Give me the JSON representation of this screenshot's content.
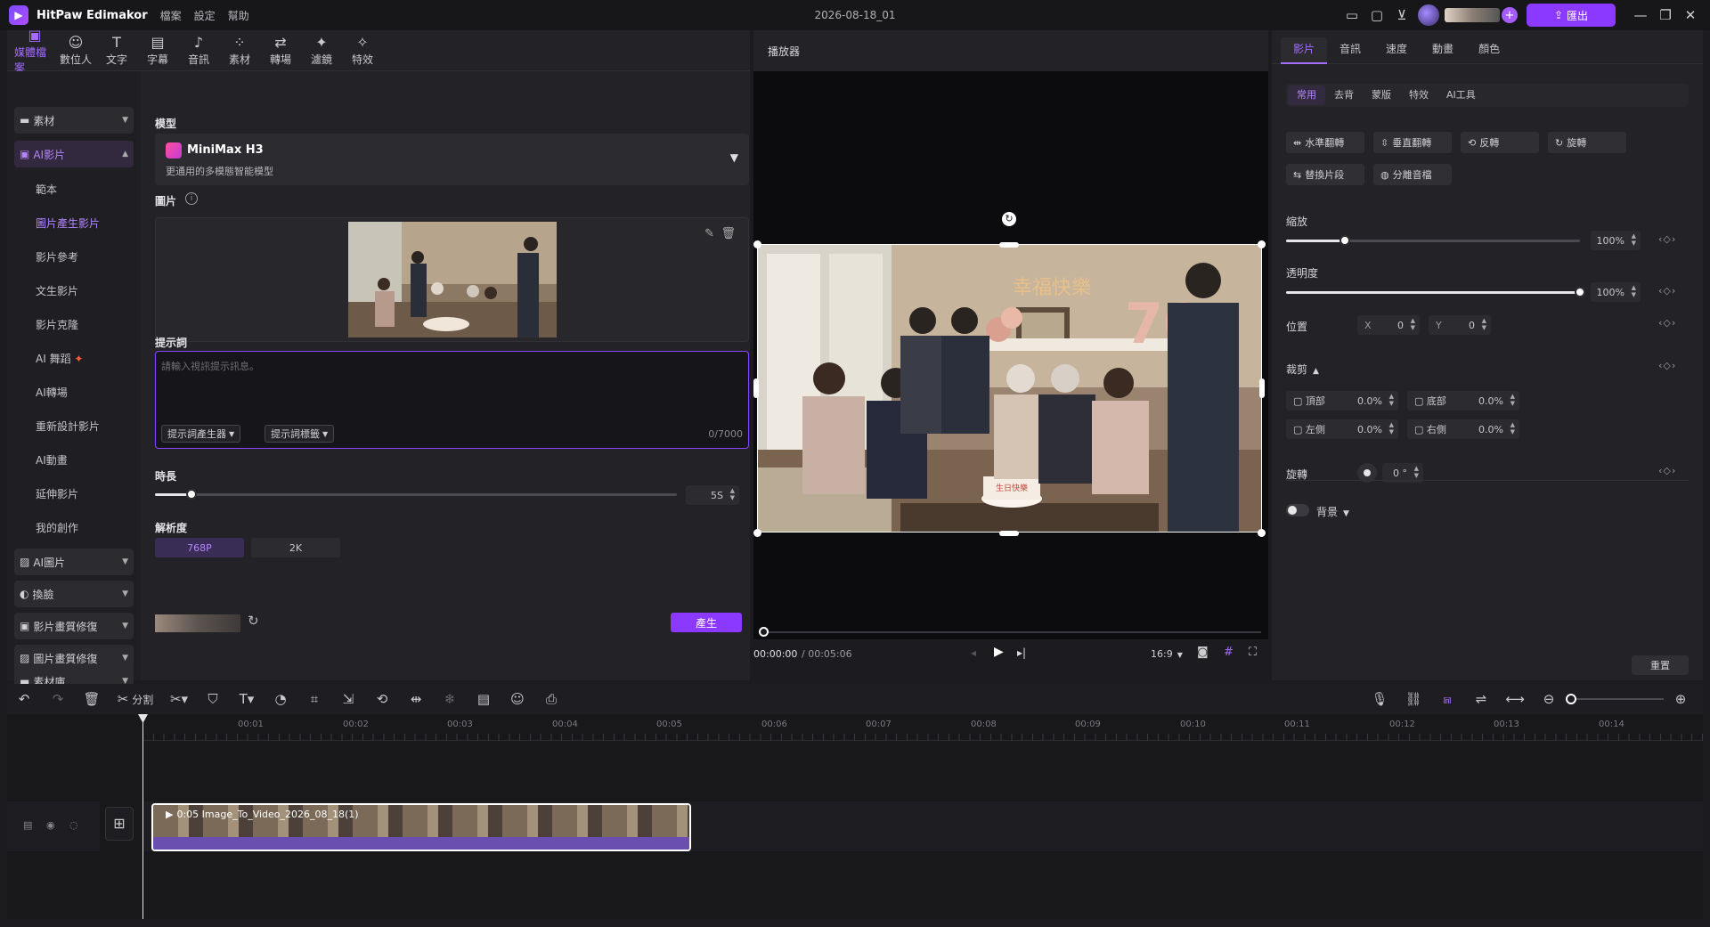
{
  "app": {
    "name": "HitPaw Edimakor",
    "doc_title": "2026-08-18_01",
    "export_label": "匯出"
  },
  "menu": [
    "檔案",
    "設定",
    "幫助"
  ],
  "top_tools": [
    {
      "label": "媒體檔案",
      "icon": "media-icon",
      "active": true
    },
    {
      "label": "數位人",
      "icon": "avatar-icon"
    },
    {
      "label": "文字",
      "icon": "text-icon"
    },
    {
      "label": "字幕",
      "icon": "subtitle-icon"
    },
    {
      "label": "音訊",
      "icon": "music-icon"
    },
    {
      "label": "素材",
      "icon": "elements-icon"
    },
    {
      "label": "轉場",
      "icon": "transition-icon"
    },
    {
      "label": "濾鏡",
      "icon": "filter-icon"
    },
    {
      "label": "特效",
      "icon": "effects-icon"
    }
  ],
  "categories": {
    "materials": "素材",
    "ai_video": "AI影片",
    "ai_video_items": [
      "範本",
      "圖片產生影片",
      "影片參考",
      "文生影片",
      "影片克隆",
      "AI 舞蹈",
      "AI轉場",
      "重新設計影片",
      "AI動畫",
      "延伸影片",
      "我的創作"
    ],
    "ai_video_active": "圖片產生影片",
    "ai_image": "AI圖片",
    "face_swap": "換臉",
    "video_enhance": "影片畫質修復",
    "image_enhance": "圖片畫質修復",
    "library": "素材庫"
  },
  "form": {
    "model_label": "模型",
    "model_name": "MiniMax H3",
    "model_desc": "更通用的多模態智能模型",
    "image_label": "圖片",
    "prompt_label": "提示詞",
    "prompt_placeholder": "請輸入視訊提示訊息。",
    "prompt_generator": "提示詞產生器",
    "prompt_tags": "提示詞標籤",
    "char_count": "0/7000",
    "duration_label": "時長",
    "duration_value": "5S",
    "duration_fraction": 0.07,
    "resolution_label": "解析度",
    "resolution_options": [
      "768P",
      "2K"
    ],
    "resolution_selected": "768P",
    "generate": "產生"
  },
  "player": {
    "title": "播放器",
    "time_current": "00:00:00",
    "time_total": "/ 00:05:06",
    "aspect": "16:9",
    "photo_banner": "幸福快樂",
    "cake_text": "生日快樂",
    "balloon_number": "70"
  },
  "props": {
    "tabs": [
      "影片",
      "音訊",
      "速度",
      "動畫",
      "顏色"
    ],
    "active_tab": "影片",
    "subtabs": [
      "常用",
      "去背",
      "蒙版",
      "特效",
      "AI工具"
    ],
    "active_subtab": "常用",
    "buttons": [
      "水準翻轉",
      "垂直翻轉",
      "反轉",
      "旋轉",
      "替換片段",
      "分離音檔"
    ],
    "scale_label": "縮放",
    "scale_value": "100%",
    "scale_fraction": 0.2,
    "opacity_label": "透明度",
    "opacity_value": "100%",
    "opacity_fraction": 1.0,
    "position_label": "位置",
    "pos_x_label": "X",
    "pos_x": "0",
    "pos_y_label": "Y",
    "pos_y": "0",
    "crop_label": "裁剪",
    "crop_top_label": "頂部",
    "crop_top": "0.0%",
    "crop_bottom_label": "底部",
    "crop_bottom": "0.0%",
    "crop_left_label": "左側",
    "crop_left": "0.0%",
    "crop_right_label": "右側",
    "crop_right": "0.0%",
    "rotate_label": "旋轉",
    "rotate_value": "0 °",
    "background_label": "背景",
    "reset": "重置"
  },
  "timeline": {
    "split_label": "分割",
    "ticks": [
      "00:01",
      "00:02",
      "00:03",
      "00:04",
      "00:05",
      "00:06",
      "00:07",
      "00:08",
      "00:09",
      "00:10",
      "00:11",
      "00:12",
      "00:13",
      "00:14"
    ],
    "clip_label": "0:05 Image_To_Video_2026_08_18(1)"
  },
  "colors": {
    "accent": "#8b39ff",
    "accent_text": "#a36bff",
    "bg": "#1c1c20",
    "panel": "#232327"
  }
}
